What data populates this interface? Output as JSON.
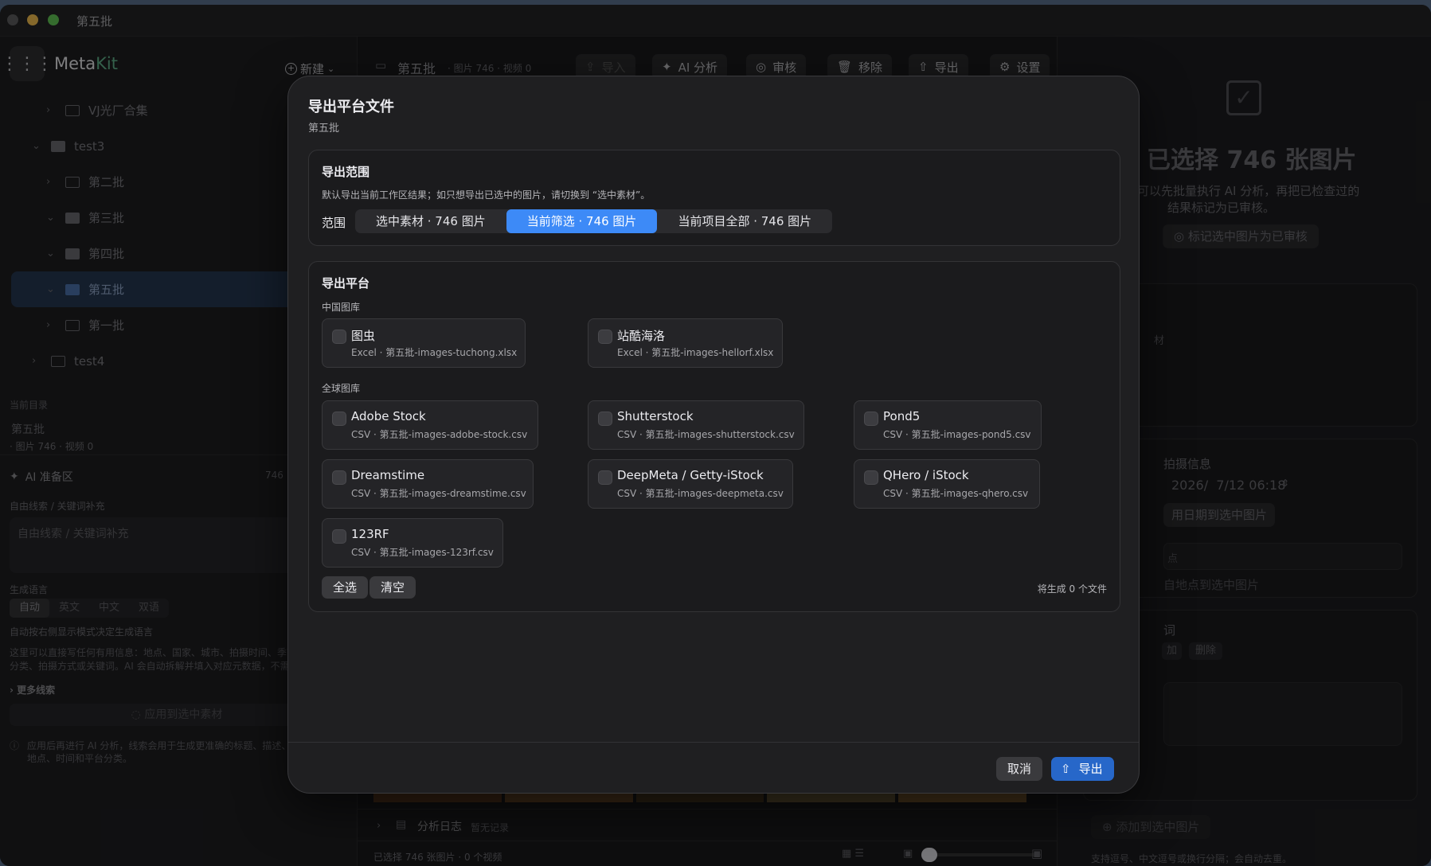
{
  "window": {
    "title": "第五批"
  },
  "sidebar": {
    "app_name_a": "Meta",
    "app_name_b": "Kit",
    "new_label": "新建",
    "tree": [
      {
        "label": "VJ光厂合集",
        "indent": 2,
        "chev": "›",
        "sel": false
      },
      {
        "label": "test3",
        "indent": 1,
        "chev": "⌄",
        "sel": false,
        "filled": true
      },
      {
        "label": "第二批",
        "indent": 2,
        "chev": "›",
        "sel": false
      },
      {
        "label": "第三批",
        "indent": 2,
        "chev": "⌄",
        "sel": false,
        "filled": true
      },
      {
        "label": "第四批",
        "indent": 2,
        "chev": "⌄",
        "sel": false,
        "filled": true
      },
      {
        "label": "第五批",
        "indent": 2,
        "chev": "⌄",
        "sel": true
      },
      {
        "label": "第一批",
        "indent": 2,
        "chev": "›",
        "sel": false
      },
      {
        "label": "test4",
        "indent": 1,
        "chev": "›",
        "sel": false
      }
    ],
    "current_dir_label": "当前目录",
    "current_dir_name": "第五批",
    "current_dir_stats": "· 图片 746 · 视频 0",
    "ai_title": "AI 准备区",
    "ai_count": "746",
    "clue_label": "自由线索 / 关键词补充",
    "clue_placeholder": "自由线索 / 关键词补充",
    "lang_label": "生成语言",
    "lang_options": [
      "自动",
      "英文",
      "中文",
      "双语"
    ],
    "lang_hint": "自动按右侧显示模式决定生成语言",
    "help_text_1": "这里可以直接写任何有用信息：地点、国家、城市、拍摄时间、季节",
    "help_text_2": "分类、拍摄方式或关键词。AI 会自动拆解并填入对应元数据，不需",
    "more_clues": "更多线索",
    "apply_button": "应用到选中素材",
    "apply_info_1": "应用后再进行 AI 分析，线索会用于生成更准确的标题、描述、",
    "apply_info_2": "地点、时间和平台分类。"
  },
  "main": {
    "folder_title": "第五批",
    "folder_stats": "· 图片 746 · 视频 0",
    "toolbar": {
      "import": "导入",
      "ai_analyze": "AI 分析",
      "review": "审核",
      "remove": "移除",
      "export": "导出",
      "settings": "设置"
    },
    "log_title": "分析日志",
    "log_status": "暂无记录",
    "status_bar": "已选择 746 张图片 · 0 个视频"
  },
  "right_panel": {
    "selected_title": "已选择 746 张图片",
    "desc_1": "可以先批量执行 AI 分析，再把已检查过的",
    "desc_2": "结果标记为已审核。",
    "mark_reviewed": "标记选中图片为已审核",
    "fragment_cai": "材",
    "shoot_info": "拍摄信息",
    "datetime": "2026/  7/12 06:18",
    "apply_date": "用日期到选中图片",
    "fragment_dian": "点",
    "apply_place": "自地点到选中图片",
    "fragment_ci": "词",
    "add": "加",
    "delete": "删除",
    "add_to_selected": "添加到选中图片",
    "footer_hint": "支持逗号、中文逗号或换行分隔；会自动去重。"
  },
  "dialog": {
    "title": "导出平台文件",
    "subtitle": "第五批",
    "scope": {
      "title": "导出范围",
      "desc": "默认导出当前工作区结果；如只想导出已选中的图片，请切换到 “选中素材”。",
      "range_label": "范围",
      "options": [
        "选中素材 · 746 图片",
        "当前筛选 · 746 图片",
        "当前项目全部 · 746 图片"
      ],
      "active_index": 1
    },
    "platforms": {
      "title": "导出平台",
      "china_label": "中国图库",
      "china": [
        {
          "name": "图虫",
          "file": "Excel · 第五批-images-tuchong.xlsx"
        },
        {
          "name": "站酷海洛",
          "file": "Excel · 第五批-images-hellorf.xlsx"
        }
      ],
      "global_label": "全球图库",
      "global": [
        {
          "name": "Adobe Stock",
          "file": "CSV · 第五批-images-adobe-stock.csv"
        },
        {
          "name": "Shutterstock",
          "file": "CSV · 第五批-images-shutterstock.csv"
        },
        {
          "name": "Pond5",
          "file": "CSV · 第五批-images-pond5.csv"
        },
        {
          "name": "Dreamstime",
          "file": "CSV · 第五批-images-dreamstime.csv"
        },
        {
          "name": "DeepMeta / Getty-iStock",
          "file": "CSV · 第五批-images-deepmeta.csv"
        },
        {
          "name": "QHero / iStock",
          "file": "CSV · 第五批-images-qhero.csv"
        },
        {
          "name": "123RF",
          "file": "CSV · 第五批-images-123rf.csv"
        }
      ],
      "select_all": "全选",
      "clear": "清空",
      "file_count": "将生成 0 个文件"
    },
    "cancel": "取消",
    "export": "导出"
  },
  "colors": {
    "accent": "#3d8af7",
    "export_btn": "#2767c9",
    "brand_kit": "#5fb089"
  }
}
